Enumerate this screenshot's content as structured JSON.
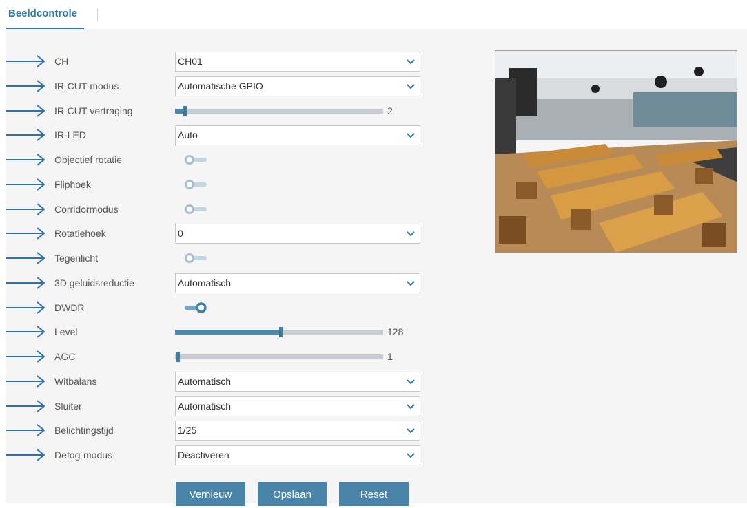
{
  "tabs": {
    "active": "Beeldcontrole"
  },
  "rows": [
    {
      "key": "ch",
      "label": "CH",
      "type": "select",
      "value": "CH01"
    },
    {
      "key": "ircut-mode",
      "label": "IR-CUT-modus",
      "type": "select",
      "value": "Automatische GPIO"
    },
    {
      "key": "ircut-delay",
      "label": "IR-CUT-vertraging",
      "type": "slider",
      "value": "2",
      "fraction": 0.04
    },
    {
      "key": "irled",
      "label": "IR-LED",
      "type": "select",
      "value": "Auto"
    },
    {
      "key": "lens-rotation",
      "label": "Objectief rotatie",
      "type": "toggle",
      "on": false
    },
    {
      "key": "flip",
      "label": "Fliphoek",
      "type": "toggle",
      "on": false
    },
    {
      "key": "corridor",
      "label": "Corridormodus",
      "type": "toggle",
      "on": false
    },
    {
      "key": "rotation-angle",
      "label": "Rotatiehoek",
      "type": "select",
      "value": "0"
    },
    {
      "key": "backlight",
      "label": "Tegenlicht",
      "type": "toggle",
      "on": false
    },
    {
      "key": "noise-reduction",
      "label": "3D geluidsreductie",
      "type": "select",
      "value": "Automatisch"
    },
    {
      "key": "dwdr",
      "label": "DWDR",
      "type": "toggle",
      "on": true
    },
    {
      "key": "level",
      "label": "Level",
      "type": "slider",
      "value": "128",
      "fraction": 0.5
    },
    {
      "key": "agc",
      "label": "AGC",
      "type": "slider",
      "value": "1",
      "fraction": 0.0
    },
    {
      "key": "white-balance",
      "label": "Witbalans",
      "type": "select",
      "value": "Automatisch"
    },
    {
      "key": "shutter",
      "label": "Sluiter",
      "type": "select",
      "value": "Automatisch"
    },
    {
      "key": "exposure-time",
      "label": "Belichtingstijd",
      "type": "select",
      "value": "1/25"
    },
    {
      "key": "defog-mode",
      "label": "Defog-modus",
      "type": "select",
      "value": "Deactiveren"
    }
  ],
  "buttons": {
    "refresh": "Vernieuw",
    "save": "Opslaan",
    "reset": "Reset"
  },
  "colors": {
    "accent": "#2f79a8",
    "button": "#4a84a8",
    "slider_fill": "#4b8aaa",
    "slider_track": "#c6ccd1",
    "toggle_off": "#a7bfcf",
    "toggle_on": "#3d82ab"
  },
  "icons": {
    "row_marker": "arrow-right-icon",
    "select": "chevron-down-icon"
  }
}
